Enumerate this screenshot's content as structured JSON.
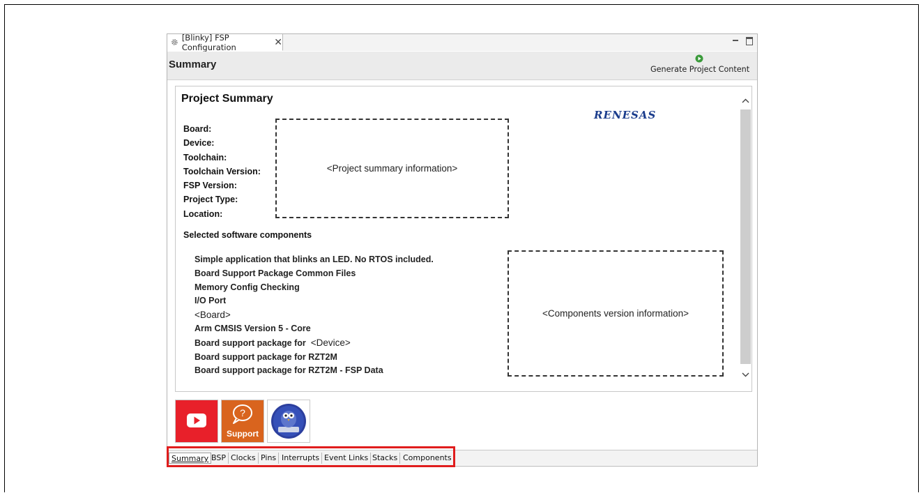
{
  "editor_tab": {
    "title": "[Blinky] FSP Configuration",
    "close": "✕"
  },
  "header": {
    "title": "Summary",
    "generate_label": "Generate Project Content"
  },
  "summary": {
    "title": "Project Summary",
    "logo": "RENESAS",
    "labels": [
      "Board:",
      "Device:",
      "Toolchain:",
      "Toolchain Version:",
      "FSP Version:",
      "Project Type:",
      "Location:"
    ],
    "info_placeholder": "<Project summary information>"
  },
  "components": {
    "heading": "Selected software components",
    "items": [
      "Simple application that blinks an LED. No RTOS included.",
      "Board Support Package Common Files",
      "Memory Config Checking",
      "I/O Port",
      "<Board>",
      "Arm CMSIS Version 5 - Core",
      "Board support package for",
      "Board support package for RZT2M",
      "Board support package for RZT2M - FSP Data"
    ],
    "device_placeholder": "<Device>",
    "version_placeholder": "<Components version information>"
  },
  "quick_links": {
    "support_label": "Support"
  },
  "bottom_tabs": [
    "Summary",
    "BSP",
    "Clocks",
    "Pins",
    "Interrupts",
    "Event Links",
    "Stacks",
    "Components"
  ],
  "colors": {
    "youtube": "#e8202a",
    "support": "#d9641e",
    "highlight": "#e01d1d",
    "logo": "#1a3c8c"
  }
}
